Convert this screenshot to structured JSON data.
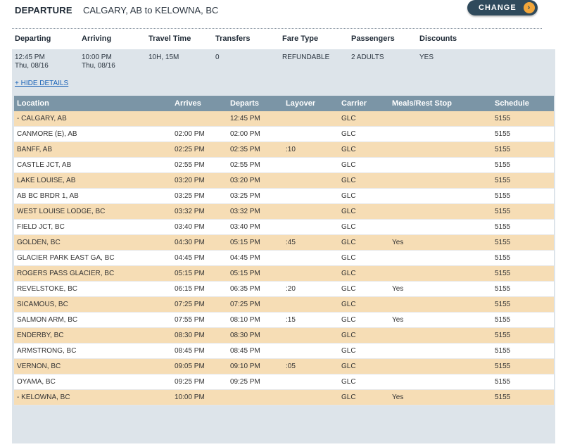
{
  "header": {
    "label": "DEPARTURE",
    "route": "CALGARY, AB to KELOWNA, BC",
    "change_label": "CHANGE",
    "change_arrow": "›"
  },
  "summary": {
    "headers": {
      "departing": "Departing",
      "arriving": "Arriving",
      "travel_time": "Travel Time",
      "transfers": "Transfers",
      "fare_type": "Fare Type",
      "passengers": "Passengers",
      "discounts": "Discounts"
    },
    "values": {
      "departing_time": "12:45 PM",
      "departing_date": "Thu, 08/16",
      "arriving_time": "10:00 PM",
      "arriving_date": "Thu, 08/16",
      "travel_time": "10H, 15M",
      "transfers": "0",
      "fare_type": "REFUNDABLE",
      "passengers": "2 ADULTS",
      "discounts": "YES"
    },
    "hide_details": "+ HIDE DETAILS"
  },
  "schedule": {
    "columns": [
      "Location",
      "Arrives",
      "Departs",
      "Layover",
      "Carrier",
      "Meals/Rest Stop",
      "Schedule"
    ],
    "rows": [
      [
        "- CALGARY, AB",
        "",
        "12:45 PM",
        "",
        "GLC",
        "",
        "5155"
      ],
      [
        "CANMORE (E), AB",
        "02:00 PM",
        "02:00 PM",
        "",
        "GLC",
        "",
        "5155"
      ],
      [
        "BANFF, AB",
        "02:25 PM",
        "02:35 PM",
        ":10",
        "GLC",
        "",
        "5155"
      ],
      [
        "CASTLE JCT, AB",
        "02:55 PM",
        "02:55 PM",
        "",
        "GLC",
        "",
        "5155"
      ],
      [
        "LAKE LOUISE, AB",
        "03:20 PM",
        "03:20 PM",
        "",
        "GLC",
        "",
        "5155"
      ],
      [
        "AB BC BRDR 1, AB",
        "03:25 PM",
        "03:25 PM",
        "",
        "GLC",
        "",
        "5155"
      ],
      [
        "WEST LOUISE LODGE, BC",
        "03:32 PM",
        "03:32 PM",
        "",
        "GLC",
        "",
        "5155"
      ],
      [
        "FIELD JCT, BC",
        "03:40 PM",
        "03:40 PM",
        "",
        "GLC",
        "",
        "5155"
      ],
      [
        "GOLDEN, BC",
        "04:30 PM",
        "05:15 PM",
        ":45",
        "GLC",
        "Yes",
        "5155"
      ],
      [
        "GLACIER PARK EAST GA, BC",
        "04:45 PM",
        "04:45 PM",
        "",
        "GLC",
        "",
        "5155"
      ],
      [
        "ROGERS PASS GLACIER, BC",
        "05:15 PM",
        "05:15 PM",
        "",
        "GLC",
        "",
        "5155"
      ],
      [
        "REVELSTOKE, BC",
        "06:15 PM",
        "06:35 PM",
        ":20",
        "GLC",
        "Yes",
        "5155"
      ],
      [
        "SICAMOUS, BC",
        "07:25 PM",
        "07:25 PM",
        "",
        "GLC",
        "",
        "5155"
      ],
      [
        "SALMON ARM, BC",
        "07:55 PM",
        "08:10 PM",
        ":15",
        "GLC",
        "Yes",
        "5155"
      ],
      [
        "ENDERBY, BC",
        "08:30 PM",
        "08:30 PM",
        "",
        "GLC",
        "",
        "5155"
      ],
      [
        "ARMSTRONG, BC",
        "08:45 PM",
        "08:45 PM",
        "",
        "GLC",
        "",
        "5155"
      ],
      [
        "VERNON, BC",
        "09:05 PM",
        "09:10 PM",
        ":05",
        "GLC",
        "",
        "5155"
      ],
      [
        "OYAMA, BC",
        "09:25 PM",
        "09:25 PM",
        "",
        "GLC",
        "",
        "5155"
      ],
      [
        "- KELOWNA, BC",
        "10:00 PM",
        "",
        "",
        "GLC",
        "Yes",
        "5155"
      ]
    ]
  },
  "colors": {
    "header_bg": "#7b95a6",
    "row_alt": "#f6ddb5",
    "button_bg": "#2f4a5c",
    "button_accent": "#f2a63a",
    "summary_bg": "#dde4ea"
  }
}
